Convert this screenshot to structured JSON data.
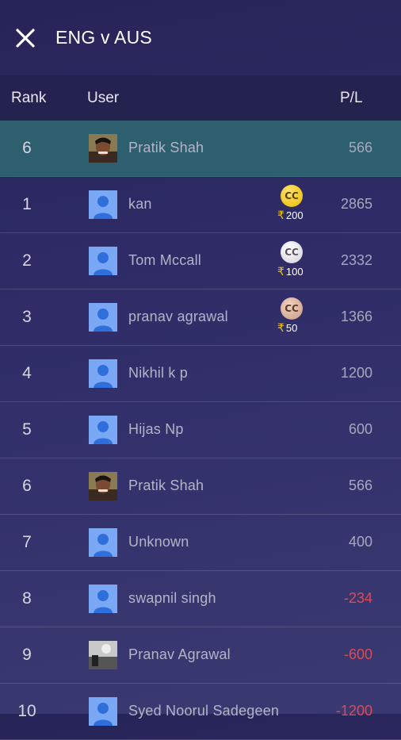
{
  "header": {
    "title": "ENG v AUS"
  },
  "columns": {
    "rank": "Rank",
    "user": "User",
    "pl": "P/L"
  },
  "colors": {
    "accent_row": "#2d5f6e",
    "negative": "#e04a54"
  },
  "current_user": {
    "rank": "6",
    "name": "Pratik Shah",
    "pl": "566",
    "avatar": "photo"
  },
  "rows": [
    {
      "rank": "1",
      "name": "kan",
      "pl": "2865",
      "avatar": "default",
      "prize": {
        "coin": "CC",
        "tier": "gold",
        "currency": "₹",
        "amount": "200"
      }
    },
    {
      "rank": "2",
      "name": "Tom Mccall",
      "pl": "2332",
      "avatar": "default",
      "prize": {
        "coin": "CC",
        "tier": "silver",
        "currency": "₹",
        "amount": "100"
      }
    },
    {
      "rank": "3",
      "name": "pranav agrawal",
      "pl": "1366",
      "avatar": "default",
      "prize": {
        "coin": "CC",
        "tier": "bronze",
        "currency": "₹",
        "amount": "50"
      }
    },
    {
      "rank": "4",
      "name": "Nikhil k p",
      "pl": "1200",
      "avatar": "default"
    },
    {
      "rank": "5",
      "name": "Hijas Np",
      "pl": "600",
      "avatar": "default"
    },
    {
      "rank": "6",
      "name": "Pratik Shah",
      "pl": "566",
      "avatar": "photo"
    },
    {
      "rank": "7",
      "name": "Unknown",
      "pl": "400",
      "avatar": "default"
    },
    {
      "rank": "8",
      "name": "swapnil singh",
      "pl": "-234",
      "avatar": "default"
    },
    {
      "rank": "9",
      "name": "Pranav Agrawal",
      "pl": "-600",
      "avatar": "photo-dark"
    },
    {
      "rank": "10",
      "name": "Syed Noorul Sadegeen",
      "pl": "-1200",
      "avatar": "default"
    }
  ]
}
